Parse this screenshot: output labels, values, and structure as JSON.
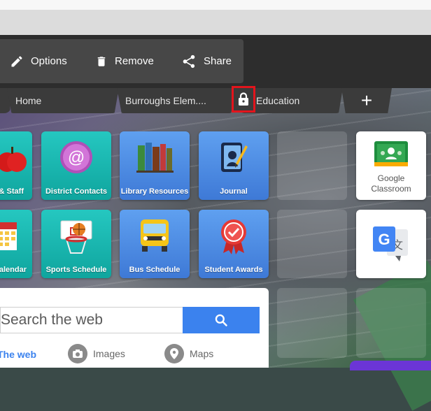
{
  "toolbar": {
    "options_label": "Options",
    "remove_label": "Remove",
    "share_label": "Share"
  },
  "tabs": [
    {
      "label": ""
    },
    {
      "label": "Home"
    },
    {
      "label": "Burroughs Elem...."
    },
    {
      "label": "Education"
    }
  ],
  "tiles_row1": [
    {
      "label": "& Staff"
    },
    {
      "label": "District Contacts"
    },
    {
      "label": "Library Resources"
    },
    {
      "label": "Journal"
    }
  ],
  "tiles_row2": [
    {
      "label": "alendar"
    },
    {
      "label": "Sports Schedule"
    },
    {
      "label": "Bus Schedule"
    },
    {
      "label": "Student Awards"
    }
  ],
  "right_tiles": {
    "classroom_line1": "Google",
    "classroom_line2": "Classroom"
  },
  "search": {
    "placeholder": "Search the web",
    "tabs": [
      "The web",
      "Images",
      "Maps"
    ]
  },
  "colors": {
    "accent_blue": "#3b82ee",
    "lock_highlight": "#e3141c",
    "teal": "#15b3ac",
    "tile_blue": "#4b86e0"
  }
}
